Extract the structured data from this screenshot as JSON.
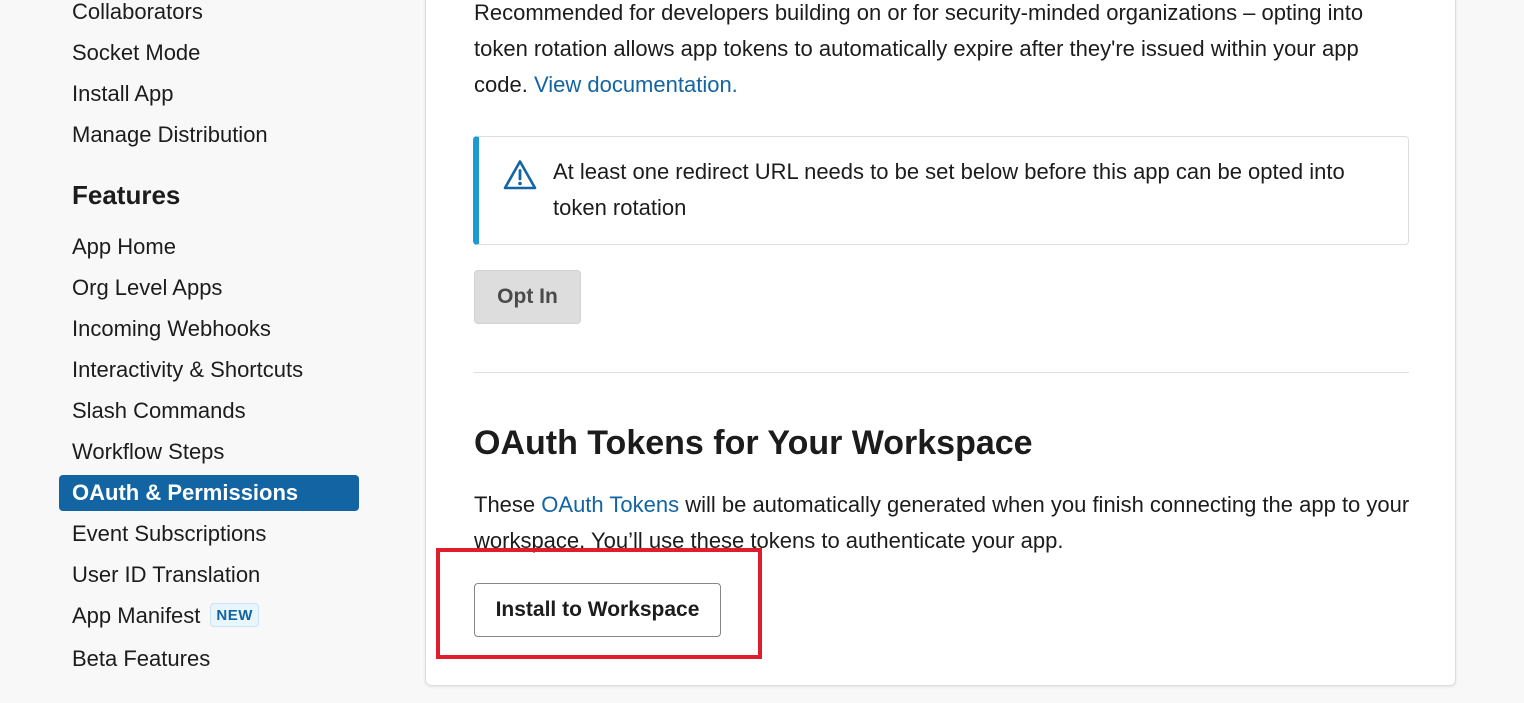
{
  "sidebar": {
    "items_top": [
      {
        "label": "Collaborators"
      },
      {
        "label": "Socket Mode"
      },
      {
        "label": "Install App"
      },
      {
        "label": "Manage Distribution"
      }
    ],
    "features_heading": "Features",
    "items_features": [
      {
        "label": "App Home"
      },
      {
        "label": "Org Level Apps"
      },
      {
        "label": "Incoming Webhooks"
      },
      {
        "label": "Interactivity & Shortcuts"
      },
      {
        "label": "Slash Commands"
      },
      {
        "label": "Workflow Steps"
      },
      {
        "label": "OAuth & Permissions",
        "active": true
      },
      {
        "label": "Event Subscriptions"
      },
      {
        "label": "User ID Translation"
      },
      {
        "label": "App Manifest",
        "badge": "NEW"
      },
      {
        "label": "Beta Features"
      }
    ]
  },
  "token_rotation": {
    "description": "Recommended for developers building on or for security-minded organizations – opting into token rotation allows app tokens to automatically expire after they're issued within your app code.",
    "doc_link": "View documentation.",
    "warning_icon": "warning-triangle-icon",
    "warning_text": "At least one redirect URL needs to be set below before this app can be opted into token rotation",
    "opt_in_label": "Opt In"
  },
  "oauth_tokens": {
    "title": "OAuth Tokens for Your Workspace",
    "desc_before": "These",
    "desc_link": "OAuth Tokens",
    "desc_after": "will be automatically generated when you finish connecting the app to your workspace. You’ll use these tokens to authenticate your app.",
    "install_label": "Install to Workspace"
  },
  "colors": {
    "accent": "#1264a3",
    "callout_border": "#1d9bd1",
    "highlight": "#e01e2b"
  }
}
